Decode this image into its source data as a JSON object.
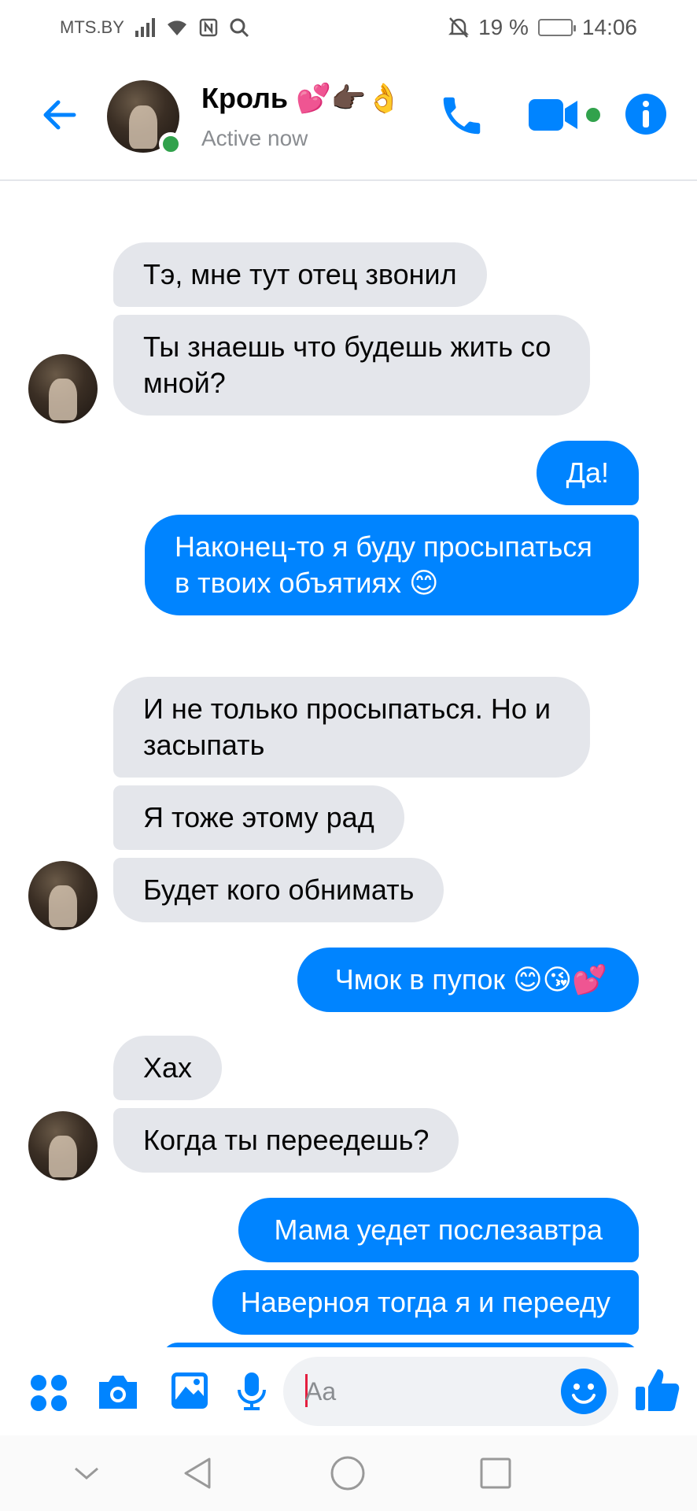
{
  "status_bar": {
    "carrier": "MTS.BY",
    "battery_text": "19 %",
    "battery_level": 0.19,
    "time": "14:06"
  },
  "header": {
    "contact_name": "Кроль 💕👉🏿👌",
    "status": "Active now"
  },
  "messages": [
    {
      "side": "in",
      "text": "Тэ, мне тут отец звонил"
    },
    {
      "side": "in",
      "text": "Ты знаешь что будешь жить со мной?"
    },
    {
      "side": "out",
      "text": "Да!"
    },
    {
      "side": "out",
      "text": "Наконец-то я буду просыпаться в твоих объятиях 😊"
    },
    {
      "side": "in",
      "text": "И не только просыпаться. Но и засыпать"
    },
    {
      "side": "in",
      "text": "Я тоже этому рад"
    },
    {
      "side": "in",
      "text": "Будет кого обнимать"
    },
    {
      "side": "out",
      "text": "Чмок в пупок 😊😘💕"
    },
    {
      "side": "in",
      "text": "Хах"
    },
    {
      "side": "in",
      "text": "Когда ты переедешь?"
    },
    {
      "side": "out",
      "text": "Мама уедет послезавтра"
    },
    {
      "side": "out",
      "text": "Наверноя тогда я и перееду"
    }
  ],
  "composer": {
    "placeholder": "Aa"
  },
  "colors": {
    "accent": "#0084ff",
    "incoming_bubble": "#e4e6eb",
    "online": "#31a24c"
  },
  "icons": [
    "back-arrow-icon",
    "phone-icon",
    "video-camera-icon",
    "info-icon",
    "apps-icon",
    "camera-icon",
    "gallery-icon",
    "microphone-icon",
    "emoji-icon",
    "thumbs-up-icon",
    "nav-back-icon",
    "nav-home-icon",
    "nav-recents-icon",
    "nav-collapse-icon"
  ]
}
